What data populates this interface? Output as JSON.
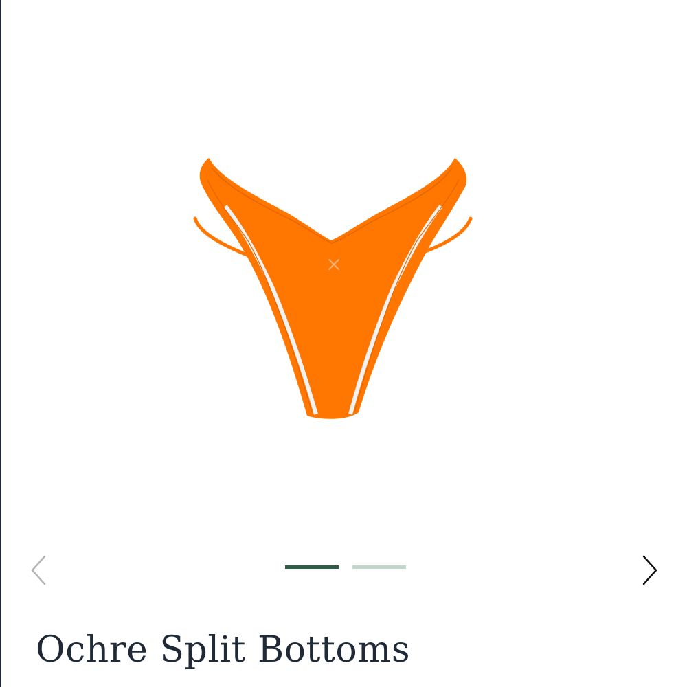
{
  "product": {
    "title": "Ochre Split Bottoms",
    "image_icon": "bikini-bottom-illustration",
    "garment_color": "#ff7600",
    "stitch_color": "#f2f2f2"
  },
  "gallery": {
    "prev_icon": "chevron-left-icon",
    "next_icon": "chevron-right-icon",
    "prev_color": "#b5b5b5",
    "next_color": "#111111",
    "slides": [
      {
        "active": true,
        "color": "#2f5e47"
      },
      {
        "active": false,
        "color": "#c3d6cc"
      }
    ]
  }
}
